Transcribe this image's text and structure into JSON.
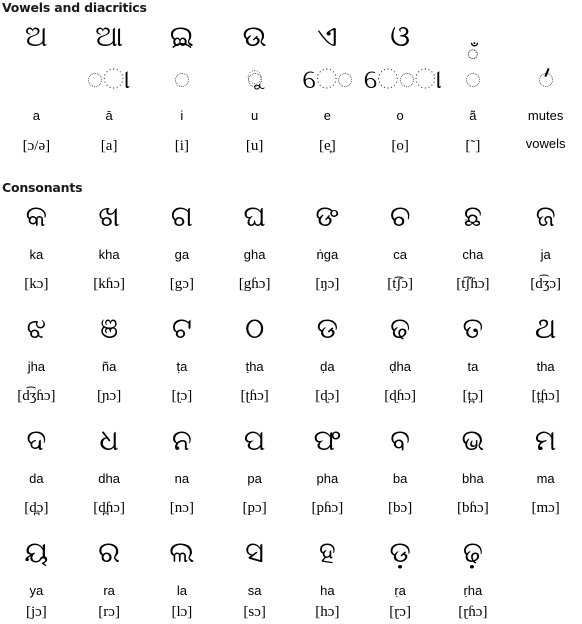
{
  "sections": {
    "vowels": {
      "header": "Vowels and diacritics",
      "columns": [
        {
          "letter": "ଅ",
          "diacritic_kind": "none",
          "roman": "a",
          "ipa": "[ɔ/ə]"
        },
        {
          "letter": "ଆ",
          "diacritic_kind": "post-bar",
          "roman": "ā",
          "ipa": "[a]"
        },
        {
          "letter": "ଇ",
          "diacritic_kind": "above-arc",
          "roman": "i",
          "ipa": "[i]"
        },
        {
          "letter": "ଉ",
          "diacritic_kind": "below-hook",
          "roman": "u",
          "ipa": "[u]"
        },
        {
          "letter": "ଏ",
          "diacritic_kind": "pre-six",
          "roman": "e",
          "ipa": "[e̞]"
        },
        {
          "letter": "ଓ",
          "diacritic_kind": "pre-six-bar",
          "roman": "o",
          "ipa": "[o]"
        },
        {
          "letter": "",
          "diacritic_kind": "above-candra",
          "roman": "ã",
          "ipa": "[˜]"
        },
        {
          "letter": "",
          "diacritic_kind": "virama",
          "roman": "mutes",
          "ipa": "vowels"
        }
      ]
    },
    "consonants": {
      "header": "Consonants",
      "rows": [
        [
          {
            "letter": "କ",
            "roman": "ka",
            "ipa": "[kɔ]"
          },
          {
            "letter": "ଖ",
            "roman": "kha",
            "ipa": "[kɦɔ]"
          },
          {
            "letter": "ଗ",
            "roman": "ga",
            "ipa": "[gɔ]"
          },
          {
            "letter": "ଘ",
            "roman": "gha",
            "ipa": "[gɦɔ]"
          },
          {
            "letter": "ଙ",
            "roman": "ṅga",
            "ipa": "[ŋɔ]"
          },
          {
            "letter": "ଚ",
            "roman": "ca",
            "ipa": "[t͡ʃɔ]"
          },
          {
            "letter": "ଛ",
            "roman": "cha",
            "ipa": "[t͡ʃɦɔ]"
          },
          {
            "letter": "ଜ",
            "roman": "ja",
            "ipa": "[d͡ʒɔ]"
          }
        ],
        [
          {
            "letter": "ଝ",
            "roman": "jha",
            "ipa": "[d͡ʒɦɔ]"
          },
          {
            "letter": "ଞ",
            "roman": "ña",
            "ipa": "[ɲɔ]"
          },
          {
            "letter": "ଟ",
            "roman": "ṭa",
            "ipa": "[ʈɔ]"
          },
          {
            "letter": "ଠ",
            "roman": "ṭha",
            "ipa": "[ʈɦɔ]"
          },
          {
            "letter": "ଡ",
            "roman": "ḍa",
            "ipa": "[ɖɔ]"
          },
          {
            "letter": "ଢ",
            "roman": "ḍha",
            "ipa": "[ɖɦɔ]"
          },
          {
            "letter": "ତ",
            "roman": "ta",
            "ipa": "[t̪ɔ]"
          },
          {
            "letter": "ଥ",
            "roman": "tha",
            "ipa": "[t̪ɦɔ]"
          }
        ],
        [
          {
            "letter": "ଦ",
            "roman": "da",
            "ipa": "[d̪ɔ]"
          },
          {
            "letter": "ଧ",
            "roman": "dha",
            "ipa": "[d̪ɦɔ]"
          },
          {
            "letter": "ନ",
            "roman": "na",
            "ipa": "[nɔ]"
          },
          {
            "letter": "ପ",
            "roman": "pa",
            "ipa": "[pɔ]"
          },
          {
            "letter": "ଫ",
            "roman": "pha",
            "ipa": "[pɦɔ]"
          },
          {
            "letter": "ବ",
            "roman": "ba",
            "ipa": "[bɔ]"
          },
          {
            "letter": "ଭ",
            "roman": "bha",
            "ipa": "[bɦɔ]"
          },
          {
            "letter": "ମ",
            "roman": "ma",
            "ipa": "[mɔ]"
          }
        ],
        [
          {
            "letter": "ୟ",
            "roman": "ya",
            "ipa": "[jɔ]"
          },
          {
            "letter": "ର",
            "roman": "ra",
            "ipa": "[rɔ]"
          },
          {
            "letter": "ଲ",
            "roman": "la",
            "ipa": "[lɔ]"
          },
          {
            "letter": "ସ",
            "roman": "sa",
            "ipa": "[sɔ]"
          },
          {
            "letter": "ହ",
            "roman": "ha",
            "ipa": "[hɔ]"
          },
          {
            "letter": "ଡ଼",
            "roman": "ṛa",
            "ipa": "[ɽɔ]"
          },
          {
            "letter": "ଢ଼",
            "roman": "ṛha",
            "ipa": "[ɽɦɔ]"
          },
          {
            "letter": "",
            "roman": "",
            "ipa": ""
          }
        ]
      ]
    }
  }
}
